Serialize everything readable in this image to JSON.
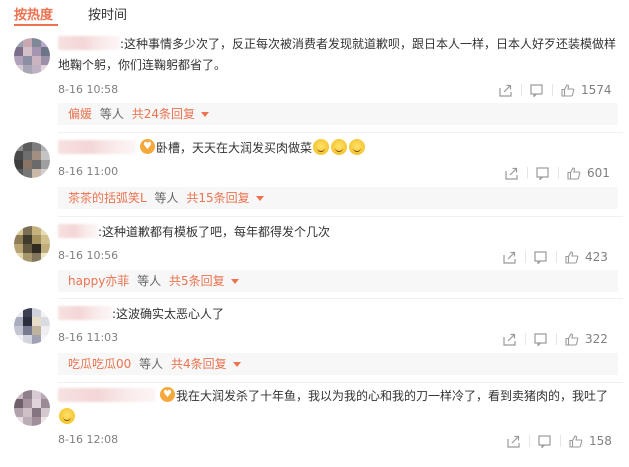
{
  "tabs": {
    "hot_label": "按热度",
    "time_label": "按时间"
  },
  "comments": [
    {
      "text": ":这种事情多少次了，反正每次被消费者发现就道歉呗，跟日本人一样，日本人好歹还装模做样\n地鞠个躬，你们连鞠躬都省了。",
      "time": "8-16 10:58",
      "likes": "1574",
      "reply_name": "偏媛",
      "reply_mid": "等人",
      "reply_count": "共24条回复"
    },
    {
      "text": "卧槽，天天在大润发买肉做菜",
      "time": "8-16 11:00",
      "likes": "601",
      "reply_name": "茶茶的括弧笑L",
      "reply_mid": "等人",
      "reply_count": "共15条回复"
    },
    {
      "text": ":这种道歉都有模板了吧，每年都得发个几次",
      "time": "8-16 10:56",
      "likes": "423",
      "reply_name": "happy亦菲",
      "reply_mid": "等人",
      "reply_count": "共5条回复"
    },
    {
      "text": ":这波确实太恶心人了",
      "time": "8-16 11:03",
      "likes": "322",
      "reply_name": "吃瓜吃瓜00",
      "reply_mid": "等人",
      "reply_count": "共4条回复"
    },
    {
      "text": "我在大润发杀了十年鱼，我以为我的心和我的刀一样冷了，看到卖猪肉的，我吐了",
      "time": "8-16 12:08",
      "likes": "158"
    }
  ],
  "colors": {
    "accent": "#eb7350",
    "muted": "#808080",
    "reply_bg": "#f7f7f7"
  },
  "icons": [
    "share-icon",
    "comment-icon",
    "like-icon",
    "vip-icon",
    "caret-down-icon",
    "emoji-icon"
  ]
}
